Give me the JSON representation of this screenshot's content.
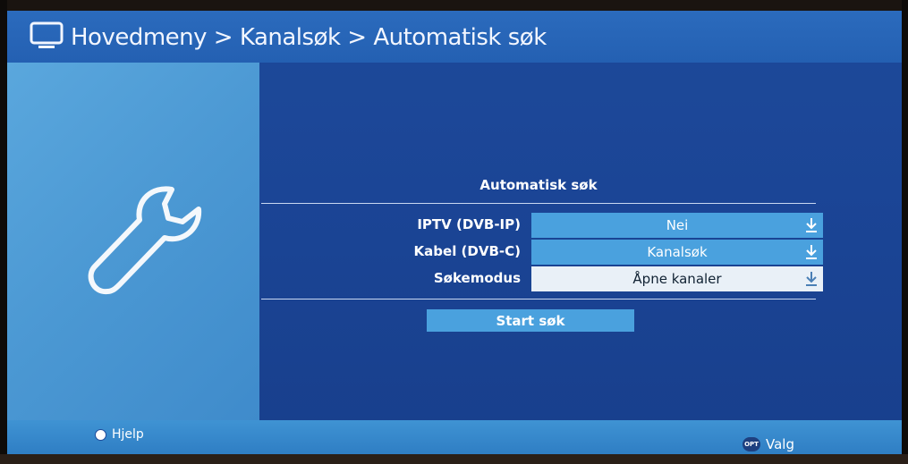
{
  "header": {
    "breadcrumb": "Hovedmeny > Kanalsøk > Automatisk søk",
    "icon": "tv-icon"
  },
  "left_panel": {
    "icon": "wrench-icon"
  },
  "dialog": {
    "title": "Automatisk søk",
    "rows": [
      {
        "label": "IPTV (DVB-IP)",
        "value": "Nei",
        "icon": "download-icon"
      },
      {
        "label": "Kabel (DVB-C)",
        "value": "Kanalsøk",
        "icon": "download-icon"
      },
      {
        "label": "Søkemodus",
        "value": "Åpne kanaler",
        "icon": "download-icon",
        "selected": true
      }
    ],
    "start_button": "Start søk"
  },
  "footer": {
    "help_label": "Hjelp",
    "opt_badge": "OPT",
    "opt_label": "Valg"
  },
  "colors": {
    "background": "#1b4596",
    "header": "#2563b4",
    "left_panel": "#4b98d3",
    "field": "#4aa1de",
    "field_selected": "#e9f0f7"
  }
}
